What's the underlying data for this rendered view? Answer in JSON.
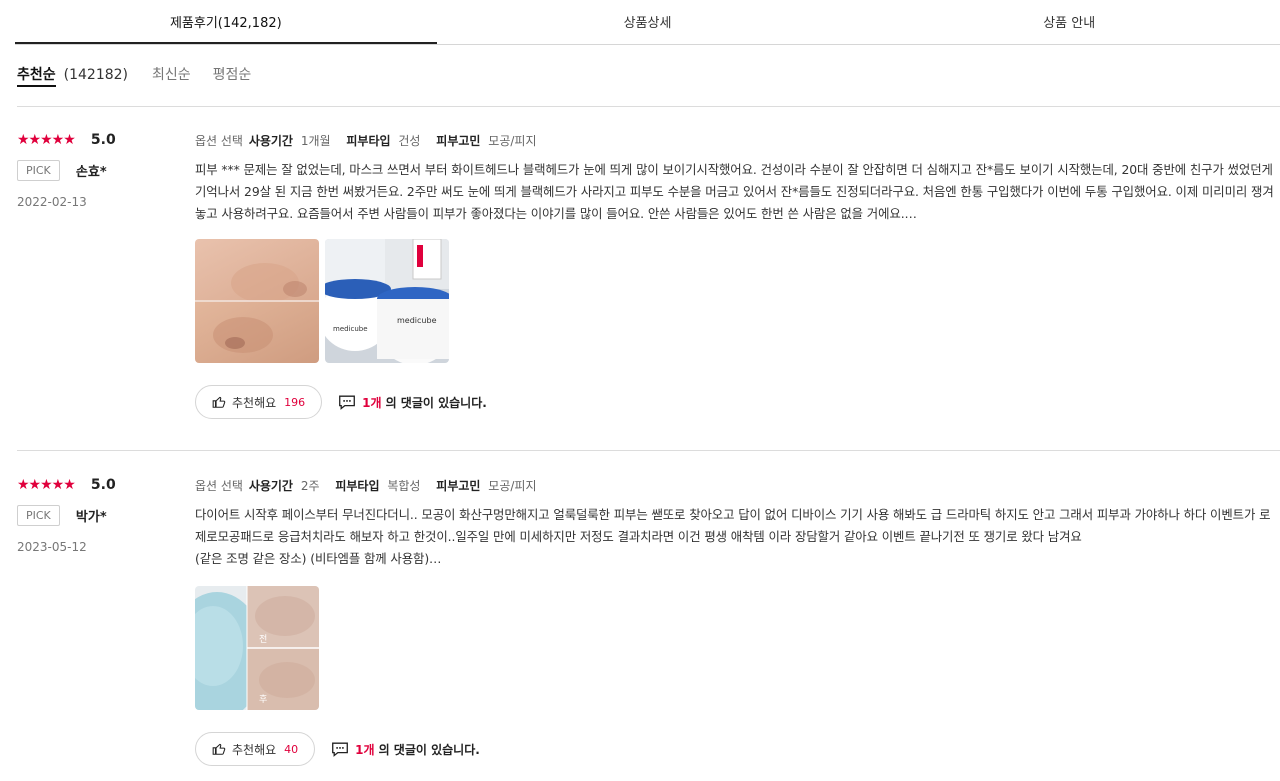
{
  "tabs": [
    {
      "label": "제품후기(142,182)"
    },
    {
      "label": "상품상세"
    },
    {
      "label": "상품 안내"
    }
  ],
  "sort": {
    "active": "추천순",
    "count": "(142182)",
    "others": [
      "최신순",
      "평점순"
    ]
  },
  "reviews": [
    {
      "stars": "★★★★★",
      "score": "5.0",
      "pick": "PICK",
      "user": "손효*",
      "date": "2022-02-13",
      "opt_select": "옵션 선택",
      "period_label": "사용기간",
      "period": "1개월",
      "skin_type_label": "피부타입",
      "skin_type": "건성",
      "concern_label": "피부고민",
      "concern": "모공/피지",
      "text": "피부 *** 문제는 잘 없었는데, 마스크 쓰면서 부터 화이트헤드나 블랙헤드가 눈에 띄게 많이 보이기시작했어요. 건성이라 수분이 잘 안잡히면 더 심해지고 잔*름도 보이기 시작했는데, 20대 중반에 친구가 썼었던게 기억나서 29살 된 지금 한번 써봤거든요. 2주만 써도 눈에 띄게 블랙헤드가 사라지고 피부도 수분을 머금고 있어서 잔*름들도 진정되더라구요. 처음엔 한통 구입했다가 이번에 두통 구입했어요. 이제 미리미리 쟁겨놓고 사용하려구요. 요즘들어서 주변 사람들이 피부가 좋아졌다는 이야기를 많이 들어요. 안쓴 사람들은 있어도 한번 쓴 사람은 없을 거에요.…",
      "like_label": "추천해요",
      "like_count": "196",
      "comment_count": "1개",
      "comment_suffix": "의 댓글이 있습니다.",
      "photo_brand": "medicube"
    },
    {
      "stars": "★★★★★",
      "score": "5.0",
      "pick": "PICK",
      "user": "박가*",
      "date": "2023-05-12",
      "opt_select": "옵션 선택",
      "period_label": "사용기간",
      "period": "2주",
      "skin_type_label": "피부타입",
      "skin_type": "복합성",
      "concern_label": "피부고민",
      "concern": "모공/피지",
      "text": "다이어트 시작후 페이스부터 무너진다더니.. 모공이 화산구멍만해지고 얼룩덜룩한 피부는 쌛또로 찾아오고 답이 없어 디바이스 기기 사용 해봐도 급 드라마틱 하지도 안고 그래서 피부과 가야하나 하다 이벤트가 로 제로모공패드로 응급처치라도 해보자 하고 한것이..일주일 만에 미세하지만 저정도 결과치라면 이건 평생 애착템 이라 장담할거 같아요 이벤트 끝나기전 또 쟁기로 왔다 남겨요",
      "text2": "(같은 조명 같은 장소) (비타엠플 함께 사용함)…",
      "like_label": "추천해요",
      "like_count": "40",
      "comment_count": "1개",
      "comment_suffix": "의 댓글이 있습니다.",
      "before_mark": "전",
      "after_mark": "후"
    }
  ]
}
